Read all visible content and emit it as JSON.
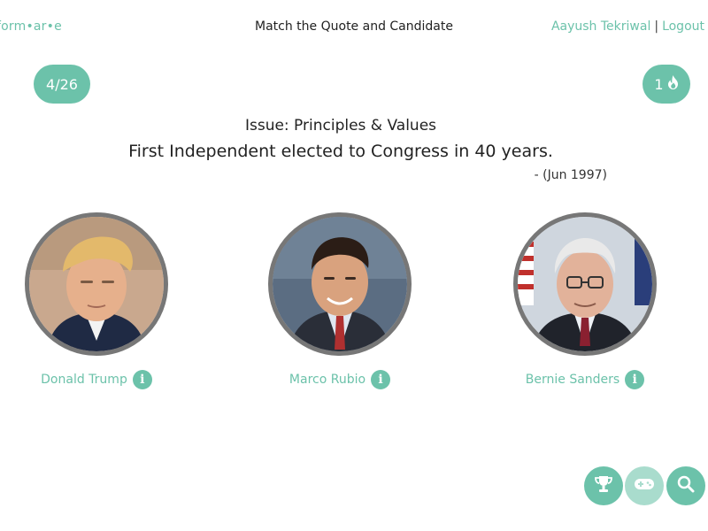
{
  "brand": {
    "text": "form•ar•e"
  },
  "header": {
    "title": "Match the Quote and Candidate"
  },
  "user": {
    "name": "Aayush Tekriwal",
    "separator": "|",
    "logout": "Logout"
  },
  "progress": {
    "text": "4/26"
  },
  "streak": {
    "count": "1"
  },
  "question": {
    "issue": "Issue: Principles & Values",
    "quote": "First Independent elected to Congress in 40 years.",
    "date": "- (Jun 1997)"
  },
  "candidates": [
    {
      "name": "Donald Trump"
    },
    {
      "name": "Marco Rubio"
    },
    {
      "name": "Bernie Sanders"
    }
  ],
  "colors": {
    "accent": "#6cc2aa",
    "accent_light": "#a9dccd",
    "ring": "#777777"
  },
  "icons": {
    "streak": "flame-icon",
    "info": "info-icon",
    "trophy": "trophy-icon",
    "game": "gamepad-icon",
    "search": "search-icon"
  }
}
